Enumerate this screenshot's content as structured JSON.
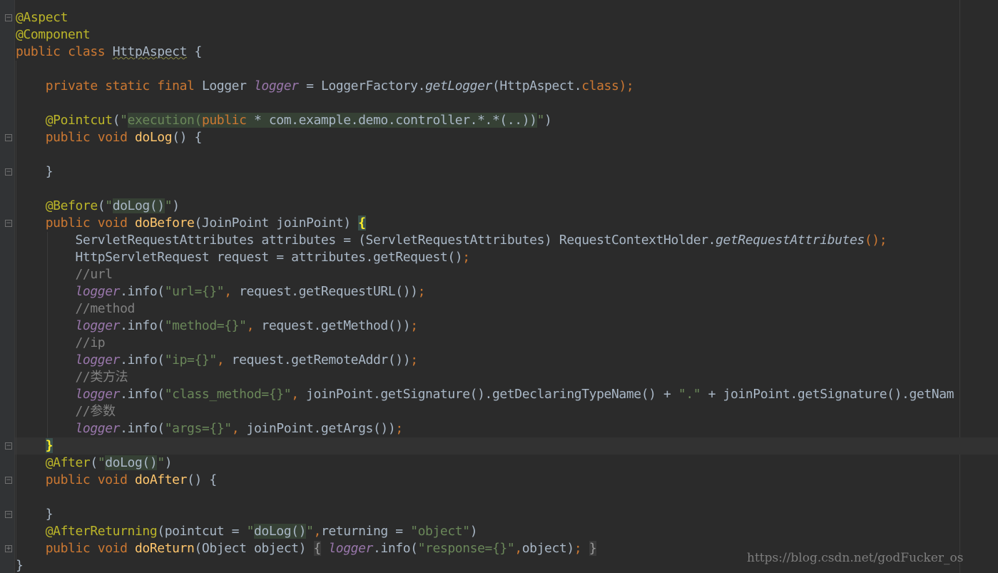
{
  "code": {
    "l1": "@Aspect",
    "l2": "@Component",
    "l3_public": "public",
    "l3_class": "class",
    "l3_name": "HttpAspect",
    "l3_brace": "{",
    "l5_mods": "private static final",
    "l5_type": "Logger",
    "l5_field": "logger",
    "l5_eq": "=",
    "l5_factory": "LoggerFactory.",
    "l5_method": "getLogger",
    "l5_arg_open": "(HttpAspect.",
    "l5_class": "class",
    "l5_end": ");",
    "l7_ann": "@Pointcut",
    "l7_open": "(",
    "l7_q": "\"",
    "l7_exec": "execution(",
    "l7_public": "public",
    "l7_rest": " * com.example.demo.controller.*.*(..))",
    "l7_close": ")",
    "l8_mods": "public void",
    "l8_name": "doLog",
    "l8_rest": "() {",
    "l10": "}",
    "l12_ann": "@Before",
    "l12_open": "(",
    "l12_q": "\"",
    "l12_inner": "doLog()",
    "l12_close": ")",
    "l13_mods": "public void",
    "l13_name": "doBefore",
    "l13_params": "(JoinPoint joinPoint) ",
    "l13_brace": "{",
    "l14_a": "ServletRequestAttributes attributes = (ServletRequestAttributes) RequestContextHolder.",
    "l14_method": "getRequestAttributes",
    "l14_end": "();",
    "l15_a": "HttpServletRequest request = attributes.getRequest()",
    "l15_semi": ";",
    "l16": "//url",
    "l17_field": "logger",
    "l17_a": ".info(",
    "l17_str": "\"url={}\"",
    "l17_comma": ",",
    "l17_b": " request.getRequestURL())",
    "l17_semi": ";",
    "l18": "//method",
    "l19_field": "logger",
    "l19_a": ".info(",
    "l19_str": "\"method={}\"",
    "l19_comma": ",",
    "l19_b": " request.getMethod())",
    "l19_semi": ";",
    "l20": "//ip",
    "l21_field": "logger",
    "l21_a": ".info(",
    "l21_str": "\"ip={}\"",
    "l21_comma": ",",
    "l21_b": " request.getRemoteAddr())",
    "l21_semi": ";",
    "l22": "//类方法",
    "l23_field": "logger",
    "l23_a": ".info(",
    "l23_str": "\"class_method={}\"",
    "l23_comma": ",",
    "l23_b": " joinPoint.getSignature().getDeclaringTypeName() + ",
    "l23_dot": "\".\"",
    "l23_c": " + joinPoint.getSignature().getNam",
    "l24": "//参数",
    "l25_field": "logger",
    "l25_a": ".info(",
    "l25_str": "\"args={}\"",
    "l25_comma": ",",
    "l25_b": " joinPoint.getArgs())",
    "l25_semi": ";",
    "l26": "}",
    "l27_ann": "@After",
    "l27_open": "(",
    "l27_q": "\"",
    "l27_inner": "doLog()",
    "l27_close": ")",
    "l28_mods": "public void",
    "l28_name": "doAfter",
    "l28_rest": "() {",
    "l30": "}",
    "l31_ann": "@AfterReturning",
    "l31_a": "(pointcut = ",
    "l31_q": "\"",
    "l31_inner": "doLog()",
    "l31_comma": ",",
    "l31_b": "returning = ",
    "l31_str": "\"object\"",
    "l31_close": ")",
    "l32_mods": "public void",
    "l32_name": "doReturn",
    "l32_params": "(Object object)",
    "l32_fold_open": "{",
    "l32_field": "logger",
    "l32_a": ".info(",
    "l32_str": "\"response={}\"",
    "l32_comma": ",",
    "l32_b": "object)",
    "l32_semi": ";",
    "l32_fold_close": "}",
    "l33": "}"
  },
  "watermark": "https://blog.csdn.net/godFucker_os",
  "icons": {
    "fold_collapse": "minus-fold-icon",
    "fold_expand": "plus-fold-icon"
  },
  "colors": {
    "background": "#2b2b2b",
    "keyword": "#cc7832",
    "annotation": "#bbb529",
    "string": "#6a8759",
    "field": "#9876aa",
    "method": "#ffc66d",
    "comment": "#808080",
    "text": "#a9b7c6"
  }
}
